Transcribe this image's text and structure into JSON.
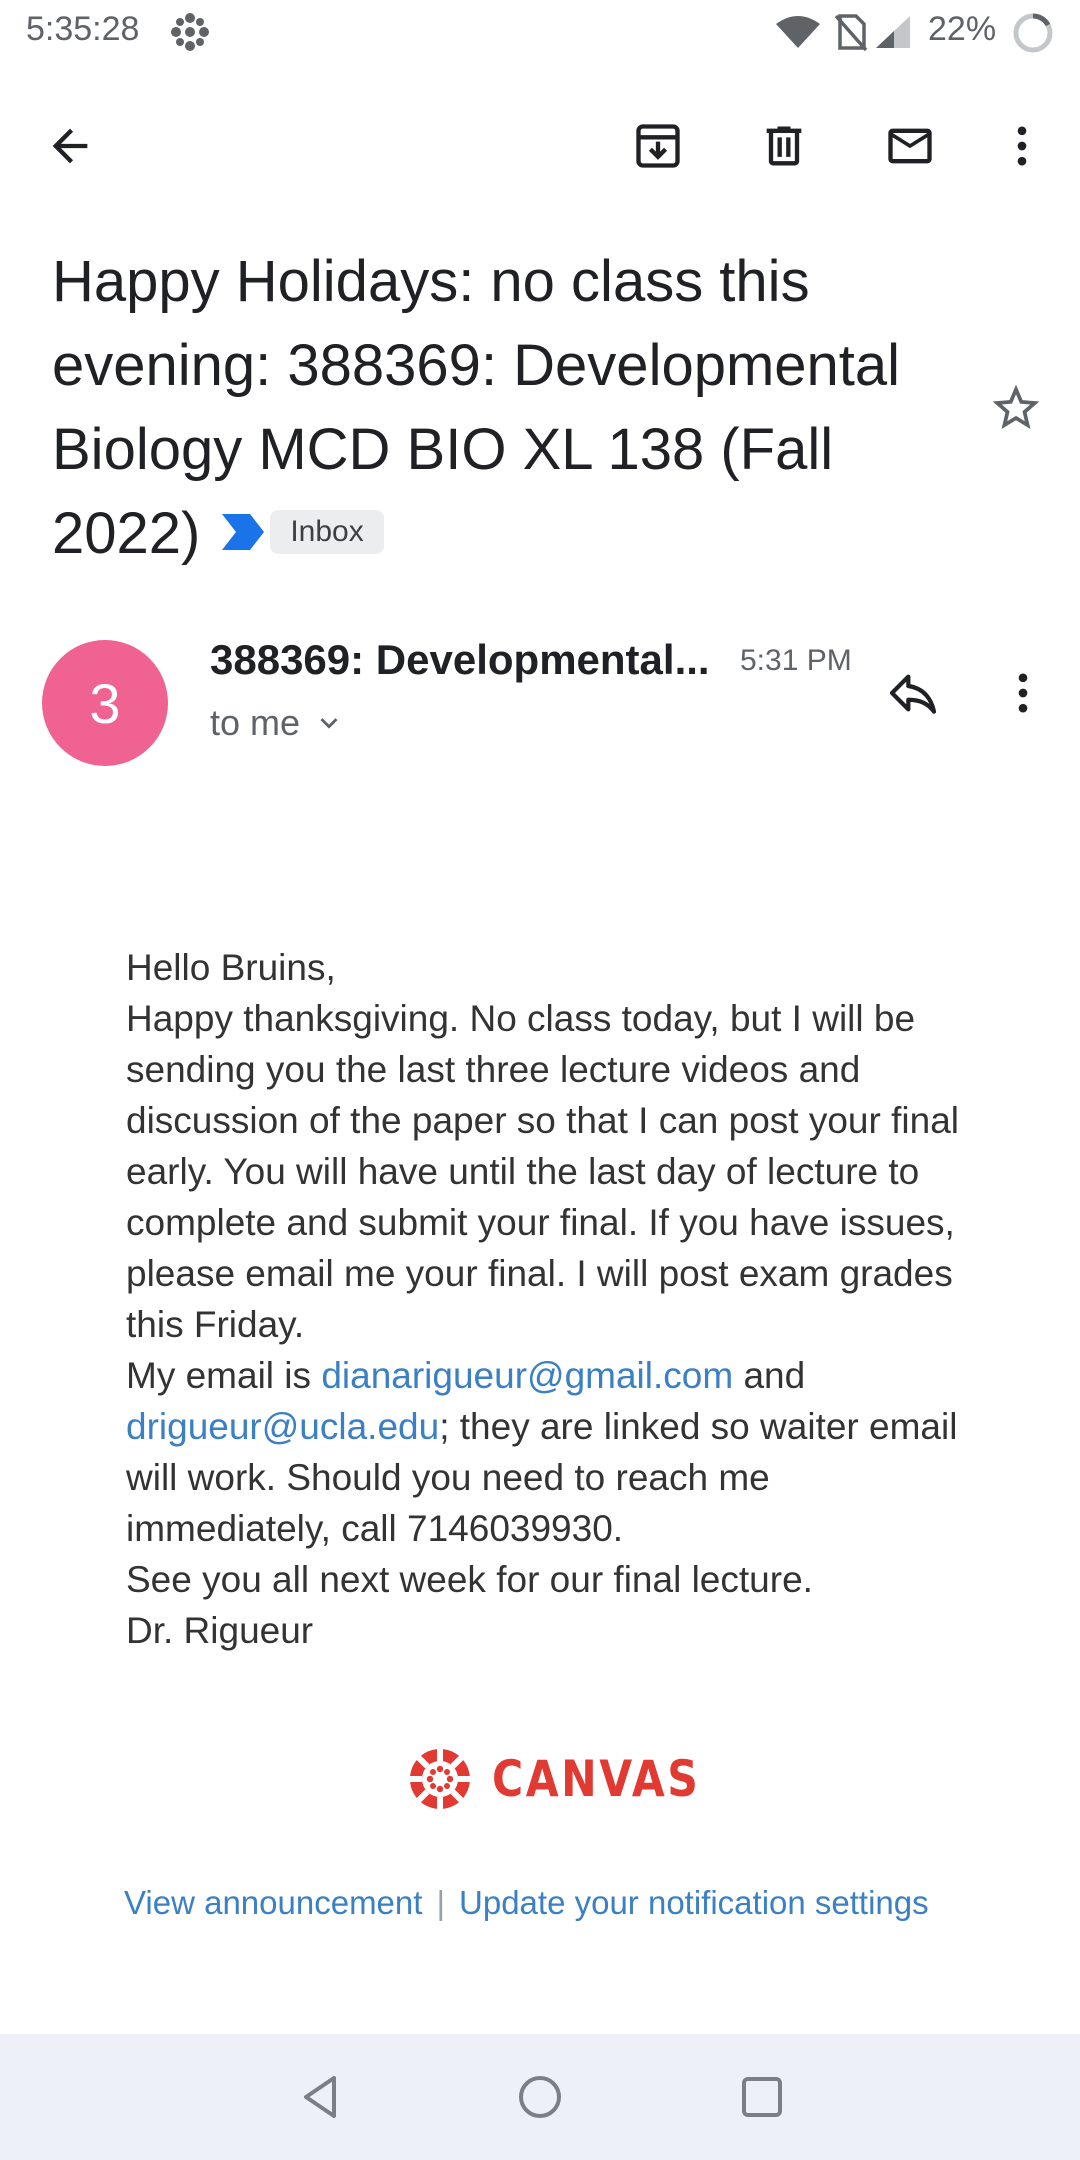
{
  "status_bar": {
    "time": "5:35:28",
    "battery_percent": "22%",
    "icons": [
      "cbc-gem-icon",
      "wifi-icon",
      "no-sim-icon",
      "signal-icon",
      "battery-icon"
    ]
  },
  "toolbar": {
    "icons": [
      "back-arrow-icon",
      "archive-icon",
      "delete-icon",
      "mark-unread-icon",
      "more-vert-icon"
    ]
  },
  "email": {
    "subject": "Happy Holidays: no class this evening: 388369: Developmental Biology MCD BIO XL 138 (Fall 2022)",
    "label": "Inbox",
    "sender_initial": "3",
    "sender_name": "388369: Developmental...",
    "time": "5:31 PM",
    "recipient": "to me",
    "body": {
      "greeting": "Hello Bruins,",
      "paragraph": "Happy thanksgiving. No class today, but I will be sending you the last three lecture videos and discussion of the paper so that I can post your final early. You will have until the last day of lecture to complete and submit your final. If you have issues, please email me your final. I will post exam grades this Friday.",
      "email_prefix": "My email is ",
      "email_link_1": "dianarigueur@gmail.com",
      "email_and": " and ",
      "email_link_2": "drigueur@ucla.edu",
      "email_suffix": "; they are linked so waiter email will work. Should you need to reach me immediately, call 7146039930.",
      "closing": "See you all next week for our final lecture.",
      "signature": "Dr. Rigueur"
    },
    "logo_text": "CANVAS",
    "footer": {
      "view_link": "View announcement",
      "separator": "|",
      "settings_link": "Update your notification settings"
    }
  },
  "colors": {
    "avatar": "#f06292",
    "link": "#3b7fc4",
    "canvas_red": "#e13a32",
    "importance_marker": "#1a73e8"
  }
}
